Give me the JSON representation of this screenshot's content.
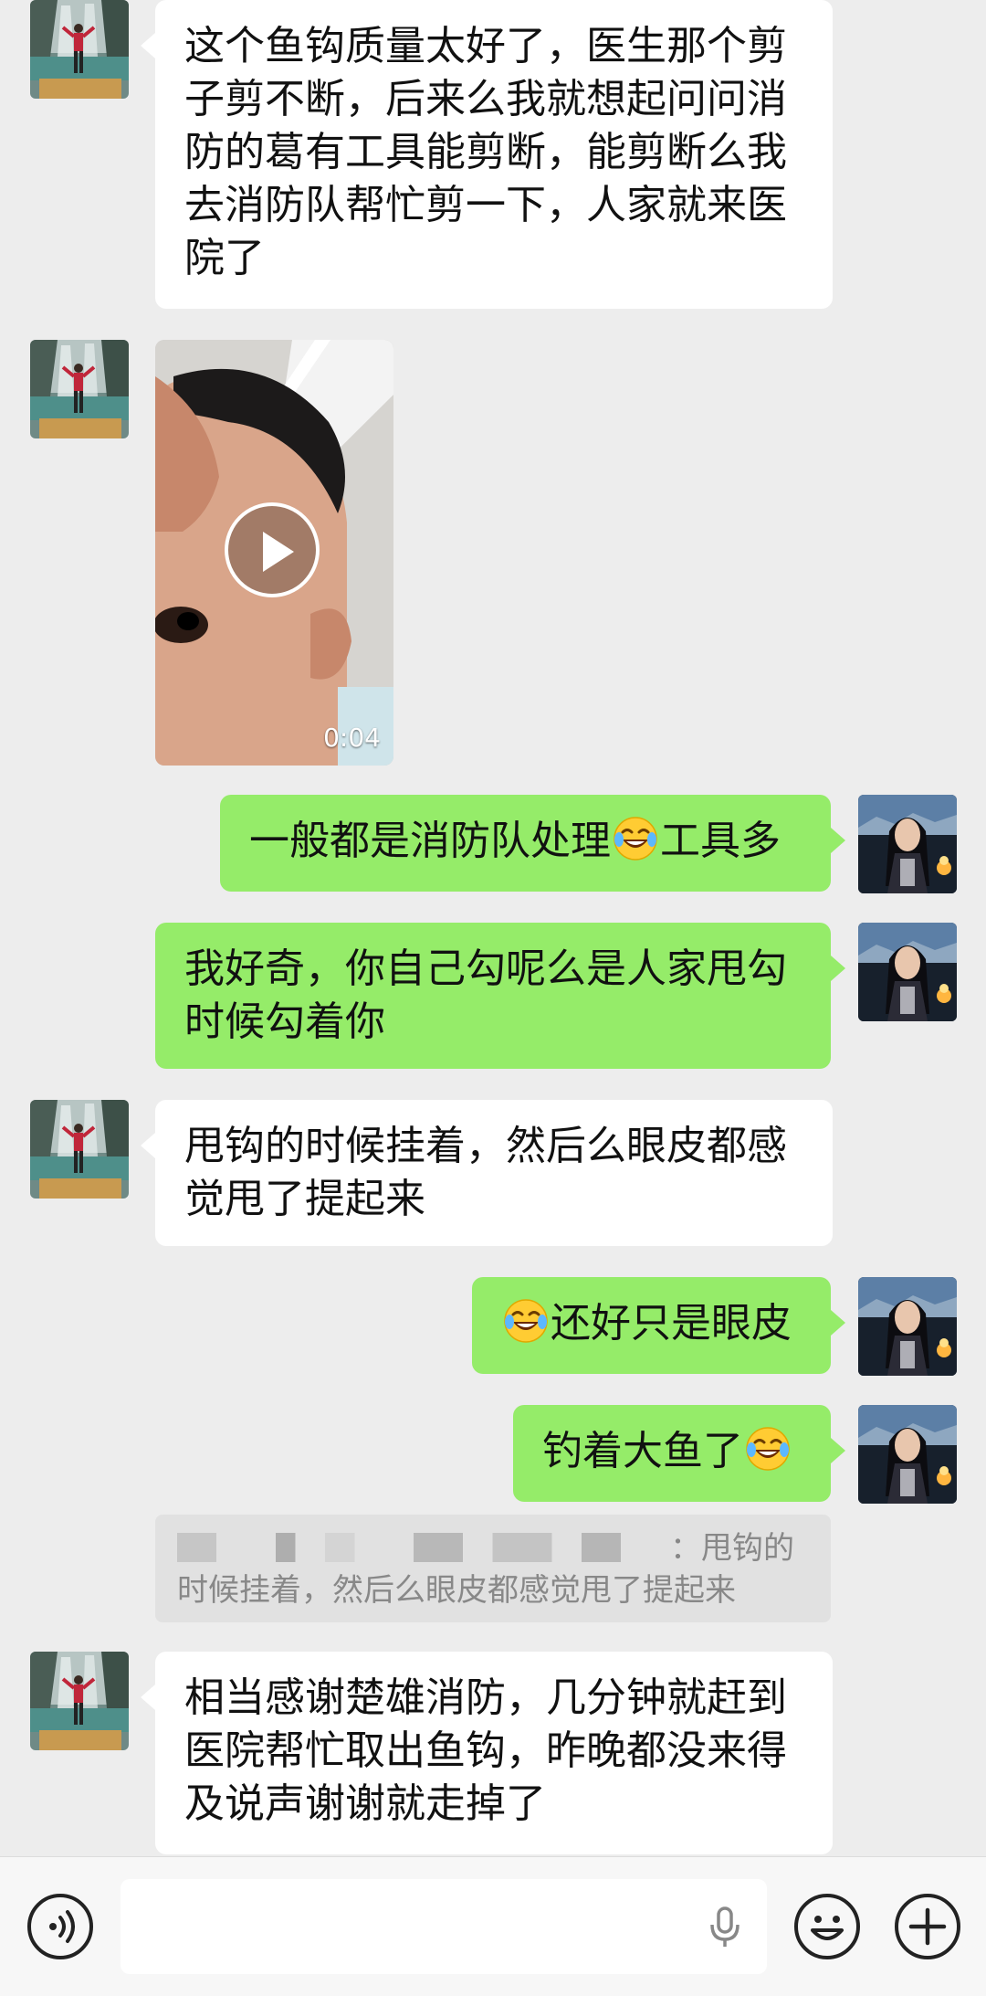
{
  "messages": [
    {
      "side": "left",
      "type": "text",
      "text": "这个鱼钩质量太好了，医生那个剪子剪不断，后来么我就想起问问消防的葛有工具能剪断，能剪断么我去消防队帮忙剪一下，人家就来医院了"
    },
    {
      "side": "left",
      "type": "video",
      "duration": "0:04"
    },
    {
      "side": "right",
      "type": "text",
      "before": "一般都是消防队处理",
      "emoji": "laughing-tears",
      "after": "工具多"
    },
    {
      "side": "right",
      "type": "text",
      "text": "我好奇，你自己勾呢么是人家甩勾时候勾着你"
    },
    {
      "side": "left",
      "type": "text",
      "text": "甩钩的时候挂着，然后么眼皮都感觉甩了提起来"
    },
    {
      "side": "right",
      "type": "text",
      "emoji": "laughing-tears",
      "after": "还好只是眼皮"
    },
    {
      "side": "right",
      "type": "text",
      "before": "钓着大鱼了",
      "emoji": "laughing-tears"
    },
    {
      "side": "right",
      "type": "quote",
      "text": "：甩钩的时候挂着，然后么眼皮都感觉甩了提起来"
    },
    {
      "side": "left",
      "type": "text",
      "text": "相当感谢楚雄消防，几分钟就赶到医院帮忙取出鱼钩，昨晚都没来得及说声谢谢就走掉了"
    }
  ],
  "input_bar": {
    "placeholder": "",
    "icons": [
      "voice-icon",
      "microphone-icon",
      "emoji-icon",
      "plus-icon"
    ]
  },
  "colors": {
    "background": "#ededed",
    "incoming_bubble": "#ffffff",
    "outgoing_bubble": "#95ec69",
    "quote_background": "#e1e1e1"
  }
}
